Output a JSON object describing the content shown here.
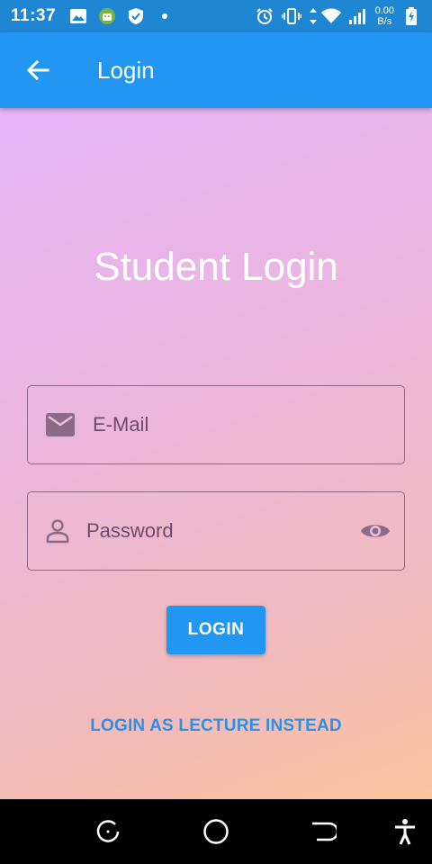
{
  "status_bar": {
    "time": "11:37",
    "net_speed_value": "0.00",
    "net_speed_unit": "B/s",
    "icons": [
      "image-icon",
      "android-icon",
      "shield-icon",
      "dot-icon",
      "alarm-icon",
      "vibrate-icon",
      "data-arrows-icon",
      "wifi-icon",
      "signal-icon",
      "battery-charging-icon"
    ]
  },
  "app_bar": {
    "title": "Login",
    "back_icon": "arrow-back-icon"
  },
  "page": {
    "heading": "Student Login"
  },
  "form": {
    "email_placeholder": "E-Mail",
    "email_icon": "mail-icon",
    "password_placeholder": "Password",
    "password_icon": "person-icon",
    "visibility_icon": "eye-icon",
    "login_label": "LOGIN",
    "alt_link_label": "LOGIN AS LECTURE INSTEAD"
  },
  "nav_bar": {
    "icons": [
      "recent-apps-icon",
      "home-icon",
      "back-nav-icon",
      "accessibility-icon"
    ]
  },
  "colors": {
    "primary": "#2196f3",
    "status_bar": "#1f86d4",
    "gradient_start": "#e6b4f7",
    "gradient_end": "#fbc49c",
    "link": "#2d8fe6",
    "field_border": "#8a6a88"
  }
}
